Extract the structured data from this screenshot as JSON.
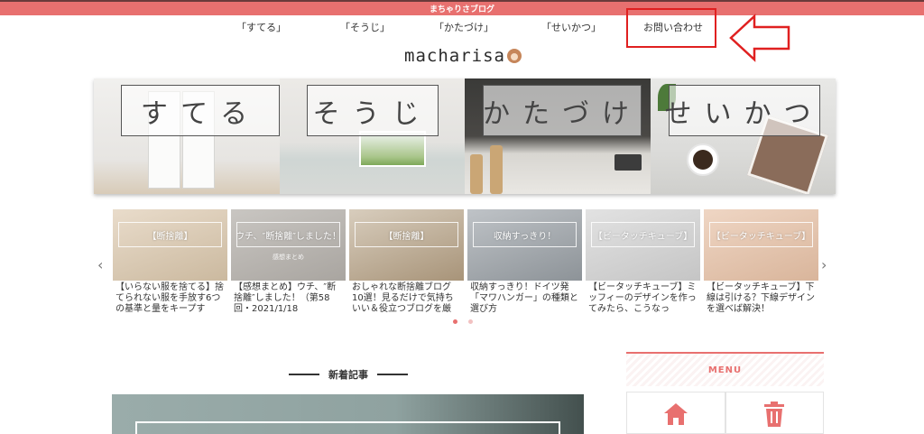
{
  "topbar": {
    "title": "まちゃりさブログ"
  },
  "nav": {
    "items": [
      "「すてる」",
      "「そうじ」",
      "「かたづけ」",
      "「せいかつ」"
    ],
    "contact": "お問い合わせ"
  },
  "logo": {
    "text": "macharisa"
  },
  "hero": {
    "panels": [
      "すてる",
      "そうじ",
      "かたづけ",
      "せいかつ"
    ]
  },
  "slider": {
    "prev_icon": "chevron-left-icon",
    "next_icon": "chevron-right-icon",
    "cards": [
      {
        "tag": "【断捨離】",
        "sub": "",
        "title": "【いらない服を捨てる】捨てられない服を手放す6つの基準と量をキープす"
      },
      {
        "tag": "「ウチ、″断捨離″しました！」",
        "sub": "感想まとめ",
        "title": "【感想まとめ】ウチ、″断捨離″しました！（第58回・2021/1/18"
      },
      {
        "tag": "【断捨離】",
        "sub": "",
        "title": "おしゃれな断捨離ブログ10選！見るだけで気持ちいい＆役立つブログを厳"
      },
      {
        "tag": "収納すっきり！",
        "sub": "",
        "title": "収納すっきり！ドイツ発「マワハンガー」の種類と選び方"
      },
      {
        "tag": "【ビータッチキューブ】",
        "sub": "",
        "title": "【ビータッチキューブ】ミッフィーのデザインを作ってみたら、こうなっ"
      },
      {
        "tag": "【ビータッチキューブ】",
        "sub": "",
        "title": "【ビータッチキューブ】下線は引ける？下線デザインを選べば解決！"
      }
    ],
    "dot_count": 2,
    "active_dot": 0
  },
  "section": {
    "title": "新着記事"
  },
  "sidebar": {
    "menu_title": "MENU",
    "tiles": [
      {
        "icon": "home-icon"
      },
      {
        "icon": "trash-icon"
      }
    ]
  },
  "colors": {
    "accent": "#e8706f",
    "highlight": "#e02020"
  }
}
